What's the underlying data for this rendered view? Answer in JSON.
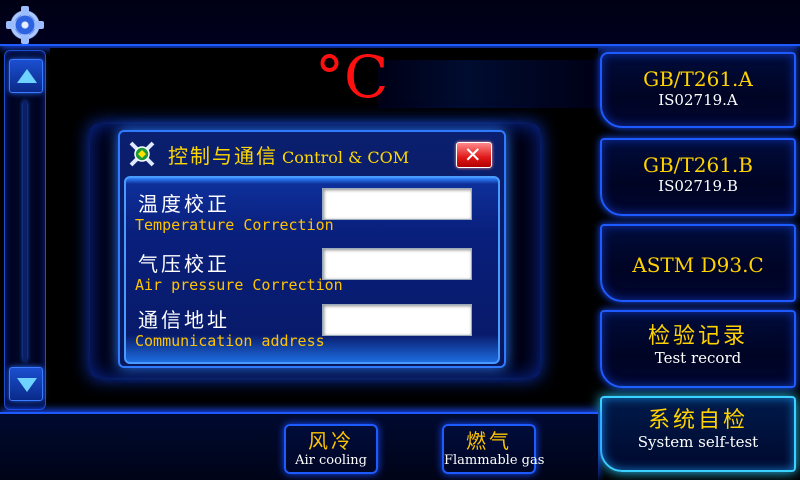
{
  "display": {
    "unit": "°C"
  },
  "dialog": {
    "title_cn": "控制与通信",
    "title_en": "Control & COM",
    "fields": [
      {
        "label_cn": "温度校正",
        "label_en": "Temperature Correction",
        "value": ""
      },
      {
        "label_cn": "气压校正",
        "label_en": "Air pressure Correction",
        "value": ""
      },
      {
        "label_cn": "通信地址",
        "label_en": "Communication address",
        "value": ""
      }
    ]
  },
  "standards": [
    {
      "line1": "GB/T261.A",
      "line2": "IS02719.A"
    },
    {
      "line1": "GB/T261.B",
      "line2": "IS02719.B"
    },
    {
      "line1": "ASTM D93.C",
      "line2": ""
    },
    {
      "line1": "检验记录",
      "line2": "Test record"
    },
    {
      "line1": "系统自检",
      "line2": "System self-test"
    }
  ],
  "bottom": {
    "air_cooling_cn": "风冷",
    "air_cooling_en": "Air cooling",
    "gas_cn": "燃气",
    "gas_en": "Flammable gas"
  },
  "colors": {
    "accent": "#1e5bff",
    "label_yellow": "#ffd200",
    "temp_red": "#ff1010"
  },
  "icons": {
    "settings": "gear-icon",
    "scroll_up": "arrow-up-icon",
    "scroll_down": "arrow-down-icon",
    "dialog": "tools-icon",
    "close": "close-icon"
  }
}
